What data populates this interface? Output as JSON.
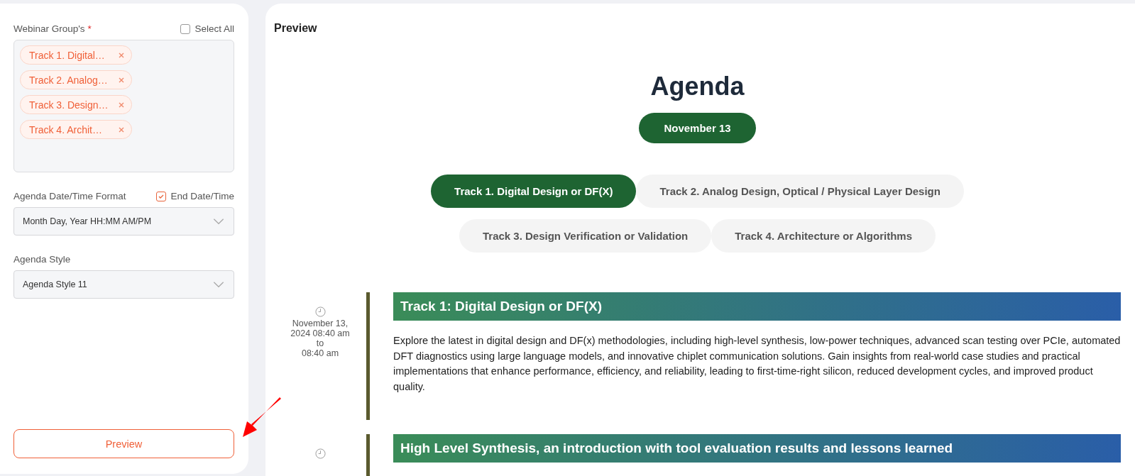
{
  "sidebar": {
    "groups": {
      "label": "Webinar Group's",
      "required": "*",
      "select_all": {
        "label": "Select All",
        "checked": false
      },
      "chips": [
        {
          "label": "Track 1. Digital…"
        },
        {
          "label": "Track 2. Analog…"
        },
        {
          "label": "Track 3. Design…"
        },
        {
          "label": "Track 4. Archit…"
        }
      ]
    },
    "date_format": {
      "label": "Agenda Date/Time Format",
      "end_toggle": {
        "label": "End Date/Time",
        "checked": true
      },
      "value": "Month Day, Year HH:MM AM/PM"
    },
    "style": {
      "label": "Agenda Style",
      "value": "Agenda Style 11"
    },
    "preview_button": "Preview"
  },
  "preview": {
    "title": "Preview",
    "heading": "Agenda",
    "date_pill": "November 13",
    "tracks": [
      {
        "label": "Track 1. Digital Design or DF(X)",
        "selected": true
      },
      {
        "label": "Track 2. Analog Design, Optical / Physical Layer Design",
        "selected": false
      },
      {
        "label": "Track 3. Design Verification or Validation",
        "selected": false
      },
      {
        "label": "Track 4. Architecture or Algorithms",
        "selected": false
      }
    ],
    "sessions": [
      {
        "time": [
          "November 13, 2024 08:40 am",
          "to",
          "08:40 am"
        ],
        "title": "Track 1: Digital Design or DF(X)",
        "description": "Explore the latest in digital design and DF(x) methodologies, including high-level synthesis, low-power techniques, advanced scan testing over PCIe, automated DFT diagnostics using large language models, and innovative chiplet communication solutions. Gain insights from real-world case studies and practical implementations that enhance performance, efficiency, and reliability, leading to first-time-right silicon, reduced development cycles, and improved product quality."
      },
      {
        "title": "High Level Synthesis, an introduction with tool evaluation results and lessons learned"
      }
    ]
  }
}
